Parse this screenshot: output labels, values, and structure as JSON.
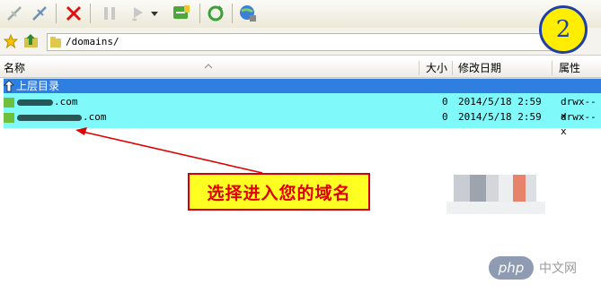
{
  "address": {
    "path": "/domains/"
  },
  "step_badge": "2",
  "columns": {
    "name": "名称",
    "size": "大小",
    "modified": "修改日期",
    "perms": "属性"
  },
  "up_row": {
    "label": "上层目录"
  },
  "files": [
    {
      "name_suffix": ".com",
      "size": "0",
      "date": "2014/5/18 2:59",
      "perms": "drwx--x"
    },
    {
      "name_suffix": ".com",
      "size": "0",
      "date": "2014/5/18 2:59",
      "perms": "drwx--x"
    }
  ],
  "callout": {
    "text": "选择进入您的域名"
  },
  "watermark": {
    "logo": "php",
    "text": "中文网"
  },
  "colors": {
    "selection": "#7ff9fa",
    "up_row": "#2f7fe0",
    "callout_bg": "#ffff22",
    "callout_text": "#e00000",
    "badge": "#ffee00"
  }
}
